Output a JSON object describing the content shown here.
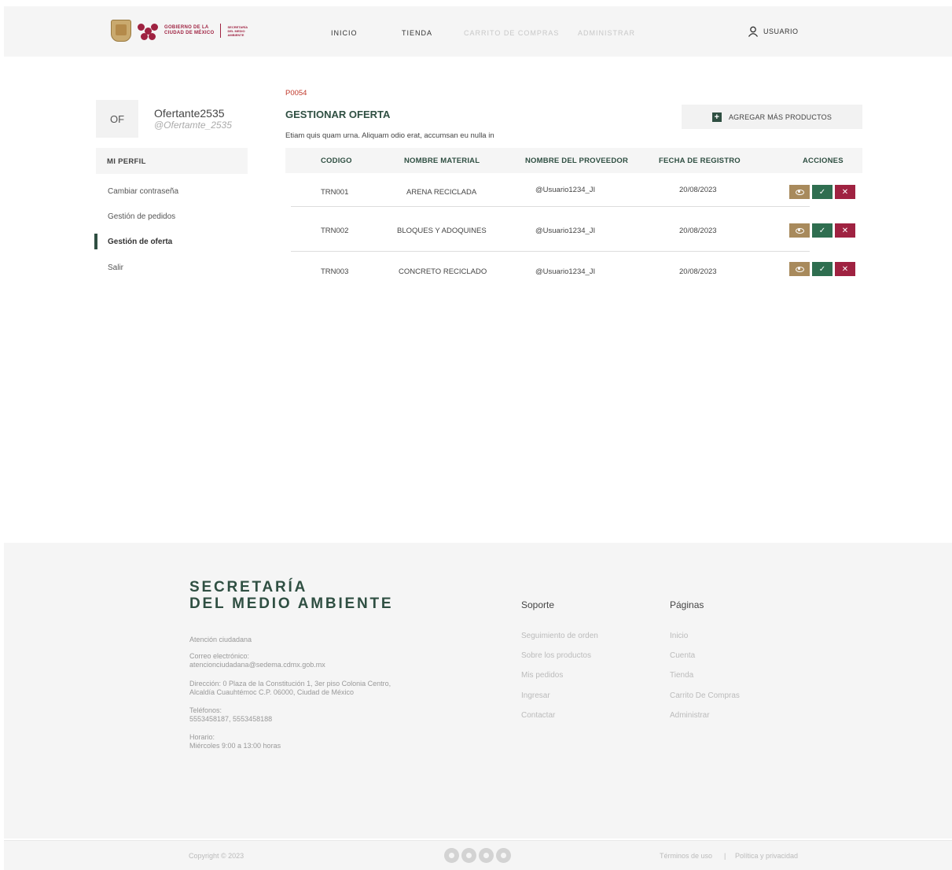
{
  "header": {
    "logo_line1": "GOBIERNO DE LA",
    "logo_line2": "CIUDAD DE MÉXICO",
    "logo_sub": "SECRETARÍA DEL MEDIO AMBIENTE",
    "nav": {
      "inicio": "INICIO",
      "tienda": "TIENDA",
      "carrito": "CARRITO DE COMPRAS",
      "administrar": "ADMINISTRAR"
    },
    "user_label": "USUARIO"
  },
  "sidebar": {
    "avatar_initials": "OF",
    "name": "Ofertante2535",
    "handle": "@Ofertamte_2535",
    "section_title": "MI PERFIL",
    "items": [
      {
        "label": "Cambiar contraseña"
      },
      {
        "label": "Gestión de pedidos"
      },
      {
        "label": "Gestión de oferta"
      },
      {
        "label": "Salir"
      }
    ]
  },
  "main": {
    "code": "P0054",
    "title": "GESTIONAR OFERTA",
    "description": "Etiam quis quam urna. Aliquam odio erat, accumsan eu nulla in",
    "add_button": "AGREGAR MÁS PRODUCTOS",
    "table": {
      "headers": [
        "CODIGO",
        "NOMBRE MATERIAL",
        "NOMBRE DEL PROVEEDOR",
        "FECHA DE REGISTRO",
        "ACCIONES"
      ],
      "rows": [
        {
          "codigo": "TRN001",
          "material": "ARENA RECICLADA",
          "proveedor": "@Usuario1234_JI",
          "fecha": "20/08/2023"
        },
        {
          "codigo": "TRN002",
          "material": "BLOQUES Y ADOQUINES",
          "proveedor": "@Usuario1234_JI",
          "fecha": "20/08/2023"
        },
        {
          "codigo": "TRN003",
          "material": "CONCRETO RECICLADO",
          "proveedor": "@Usuario1234_JI",
          "fecha": "20/08/2023"
        }
      ]
    }
  },
  "footer": {
    "brand_line1": "SECRETARÍA",
    "brand_line2": "DEL MEDIO AMBIENTE",
    "atencion": "Atención ciudadana",
    "correo_label": "Correo electrónico:",
    "correo": "atencionciudadana@sedema.cdmx.gob.mx",
    "direccion_l1": "Dirección: 0 Plaza de la Constitución 1, 3er piso Colonia Centro,",
    "direccion_l2": "Alcaldía Cuauhtémoc C.P. 06000, Ciudad de México",
    "telefonos_label": "Teléfonos:",
    "telefonos": "5553458187, 5553458188",
    "horario_label": "Horario:",
    "horario": "Miércoles 9:00 a 13:00 horas",
    "soporte": {
      "title": "Soporte",
      "links": [
        "Seguimiento de orden",
        "Sobre los productos",
        "Mis pedidos",
        "Ingresar",
        "Contactar"
      ]
    },
    "paginas": {
      "title": "Páginas",
      "links": [
        "Inicio",
        "Cuenta",
        "Tienda",
        "Carrito De Compras",
        "Administrar"
      ]
    },
    "copyright": "Copyright © 2023",
    "terminos": "Términos de uso",
    "separator": "|",
    "privacidad": "Política y privacidad"
  }
}
